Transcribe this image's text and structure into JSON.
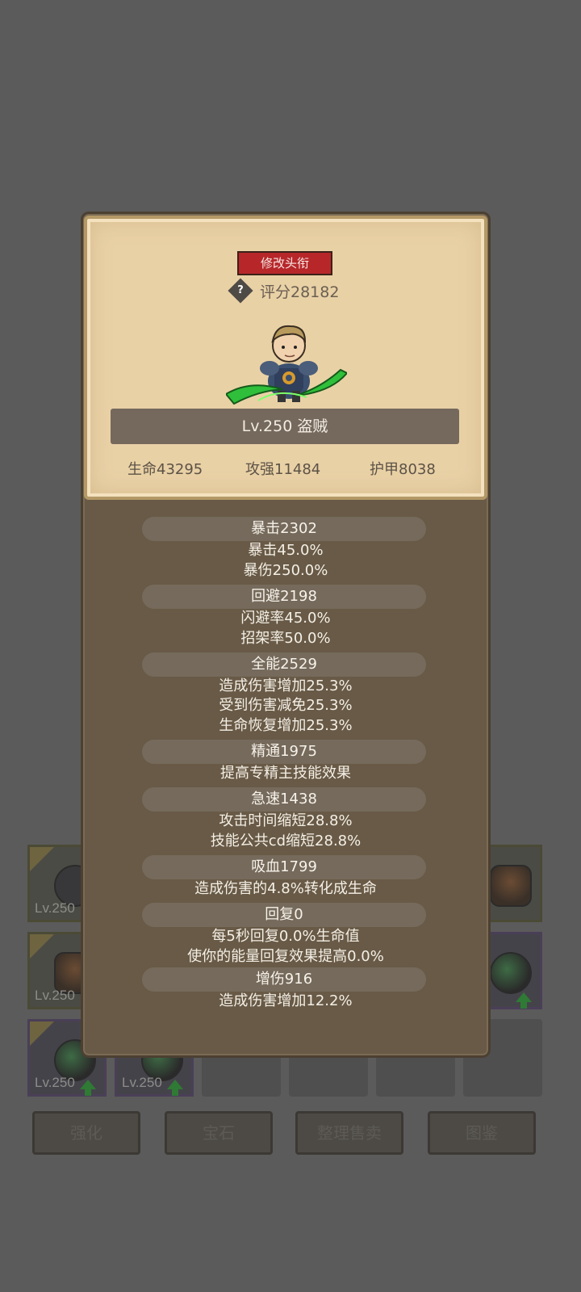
{
  "inventory": {
    "slot_level": "Lv.250",
    "buttons": [
      "强化",
      "宝石",
      "整理售卖",
      "图鉴"
    ]
  },
  "card": {
    "title_button": "修改头衔",
    "help_icon_glyph": "?",
    "score": "评分28182",
    "level_class": "Lv.250 盗贼",
    "base_stats": [
      "生命43295",
      "攻强11484",
      "护甲8038"
    ]
  },
  "stats": [
    {
      "name": "暴击2302",
      "lines": [
        "暴击45.0%",
        "暴伤250.0%"
      ]
    },
    {
      "name": "回避2198",
      "lines": [
        "闪避率45.0%",
        "招架率50.0%"
      ]
    },
    {
      "name": "全能2529",
      "lines": [
        "造成伤害增加25.3%",
        "受到伤害减免25.3%",
        "生命恢复增加25.3%"
      ]
    },
    {
      "name": "精通1975",
      "lines": [
        "提高专精主技能效果"
      ]
    },
    {
      "name": "急速1438",
      "lines": [
        "攻击时间缩短28.8%",
        "技能公共cd缩短28.8%"
      ]
    },
    {
      "name": "吸血1799",
      "lines": [
        "造成伤害的4.8%转化成生命"
      ]
    },
    {
      "name": "回复0",
      "lines": [
        "每5秒回复0.0%生命值",
        "使你的能量回复效果提高0.0%"
      ]
    },
    {
      "name": "增伤916",
      "lines": [
        "造成伤害增加12.2%"
      ]
    }
  ],
  "colors": {
    "overlay": "#5b5b5b",
    "modal": "#685a46",
    "parchment": "#e9d1a6",
    "title_button": "#b7272a",
    "stat_header": "#756a5b",
    "weapon_green": "#2fbf3a"
  }
}
